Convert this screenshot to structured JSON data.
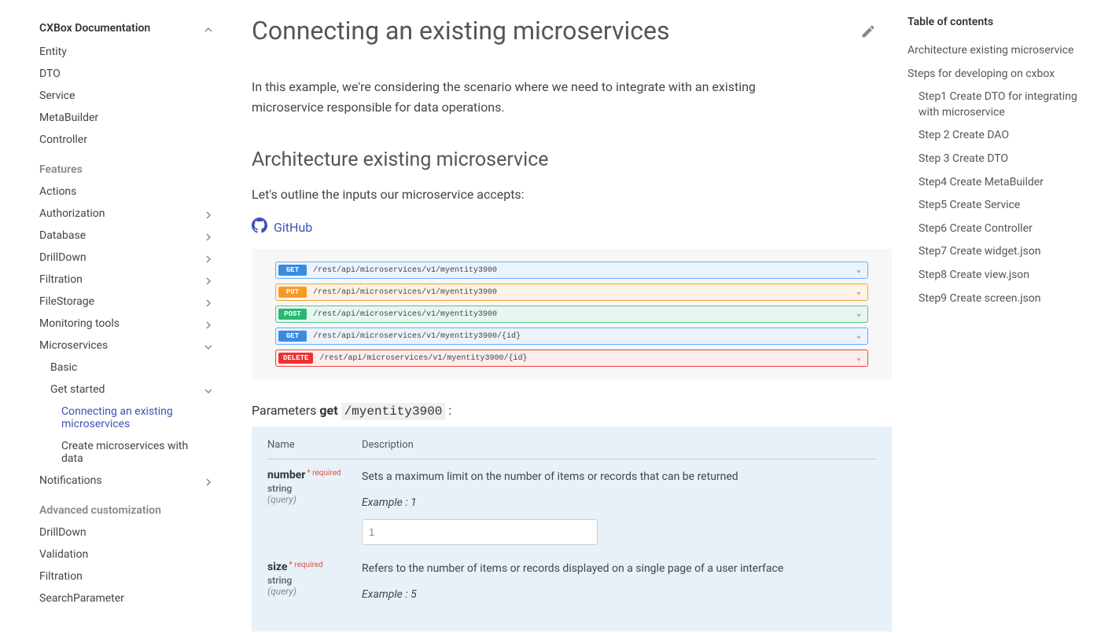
{
  "sidebar": {
    "title": "CXBox Documentation",
    "group1": [
      "Entity",
      "DTO",
      "Service",
      "MetaBuilder",
      "Controller"
    ],
    "featuresLabel": "Features",
    "features": [
      {
        "label": "Actions",
        "expandable": false
      },
      {
        "label": "Authorization",
        "expandable": true
      },
      {
        "label": "Database",
        "expandable": true
      },
      {
        "label": "DrillDown",
        "expandable": true
      },
      {
        "label": "Filtration",
        "expandable": true
      },
      {
        "label": "FileStorage",
        "expandable": true
      },
      {
        "label": "Monitoring tools",
        "expandable": true
      }
    ],
    "microservices": {
      "label": "Microservices",
      "children": [
        "Basic"
      ],
      "getStarted": {
        "label": "Get started",
        "children": [
          {
            "label": "Connecting an existing microservices",
            "active": true
          },
          {
            "label": "Create microservices with data",
            "active": false
          }
        ]
      }
    },
    "notifications": "Notifications",
    "advancedLabel": "Advanced customization",
    "advanced": [
      "DrillDown",
      "Validation",
      "Filtration",
      "SearchParameter"
    ]
  },
  "main": {
    "title": "Connecting an existing microservices",
    "intro": "In this example, we're considering the scenario where we need to integrate with an existing microservice responsible for data operations.",
    "h2": "Architecture existing microservice",
    "lead": "Let's outline the inputs our microservice accepts:",
    "github": "GitHub",
    "api": [
      {
        "method": "GET",
        "cls": "get",
        "path": "/rest/api/microservices/v1/myentity3900"
      },
      {
        "method": "PUT",
        "cls": "put",
        "path": "/rest/api/microservices/v1/myentity3900"
      },
      {
        "method": "POST",
        "cls": "post",
        "path": "/rest/api/microservices/v1/myentity3900"
      },
      {
        "method": "GET",
        "cls": "get",
        "path": "/rest/api/microservices/v1/myentity3900/{id}"
      },
      {
        "method": "DELETE",
        "cls": "delete",
        "path": "/rest/api/microservices/v1/myentity3900/{id}"
      }
    ],
    "paramsTitle": {
      "prefix": "Parameters",
      "method": "get",
      "path": "/myentity3900",
      "suffix": ":"
    },
    "paramsHeader": {
      "name": "Name",
      "desc": "Description"
    },
    "params": [
      {
        "name": "number",
        "required": "* required",
        "type": "string",
        "in": "(query)",
        "desc": "Sets a maximum limit on the number of items or records that can be returned",
        "exampleLabel": "Example",
        "exampleVal": "1",
        "input": "1"
      },
      {
        "name": "size",
        "required": "* required",
        "type": "string",
        "in": "(query)",
        "desc": "Refers to the number of items or records displayed on a single page of a user interface",
        "exampleLabel": "Example",
        "exampleVal": "5"
      }
    ]
  },
  "toc": {
    "title": "Table of contents",
    "items": [
      {
        "label": "Architecture existing microservice",
        "sub": false
      },
      {
        "label": "Steps for developing on cxbox",
        "sub": false
      },
      {
        "label": "Step1 Create DTO for integrating with microservice",
        "sub": true
      },
      {
        "label": "Step 2 Create DAO",
        "sub": true
      },
      {
        "label": "Step 3 Create DTO",
        "sub": true
      },
      {
        "label": "Step4 Create MetaBuilder",
        "sub": true
      },
      {
        "label": "Step5 Create Service",
        "sub": true
      },
      {
        "label": "Step6 Create Controller",
        "sub": true
      },
      {
        "label": "Step7 Create widget.json",
        "sub": true
      },
      {
        "label": "Step8 Create view.json",
        "sub": true
      },
      {
        "label": "Step9 Create screen.json",
        "sub": true
      }
    ]
  }
}
